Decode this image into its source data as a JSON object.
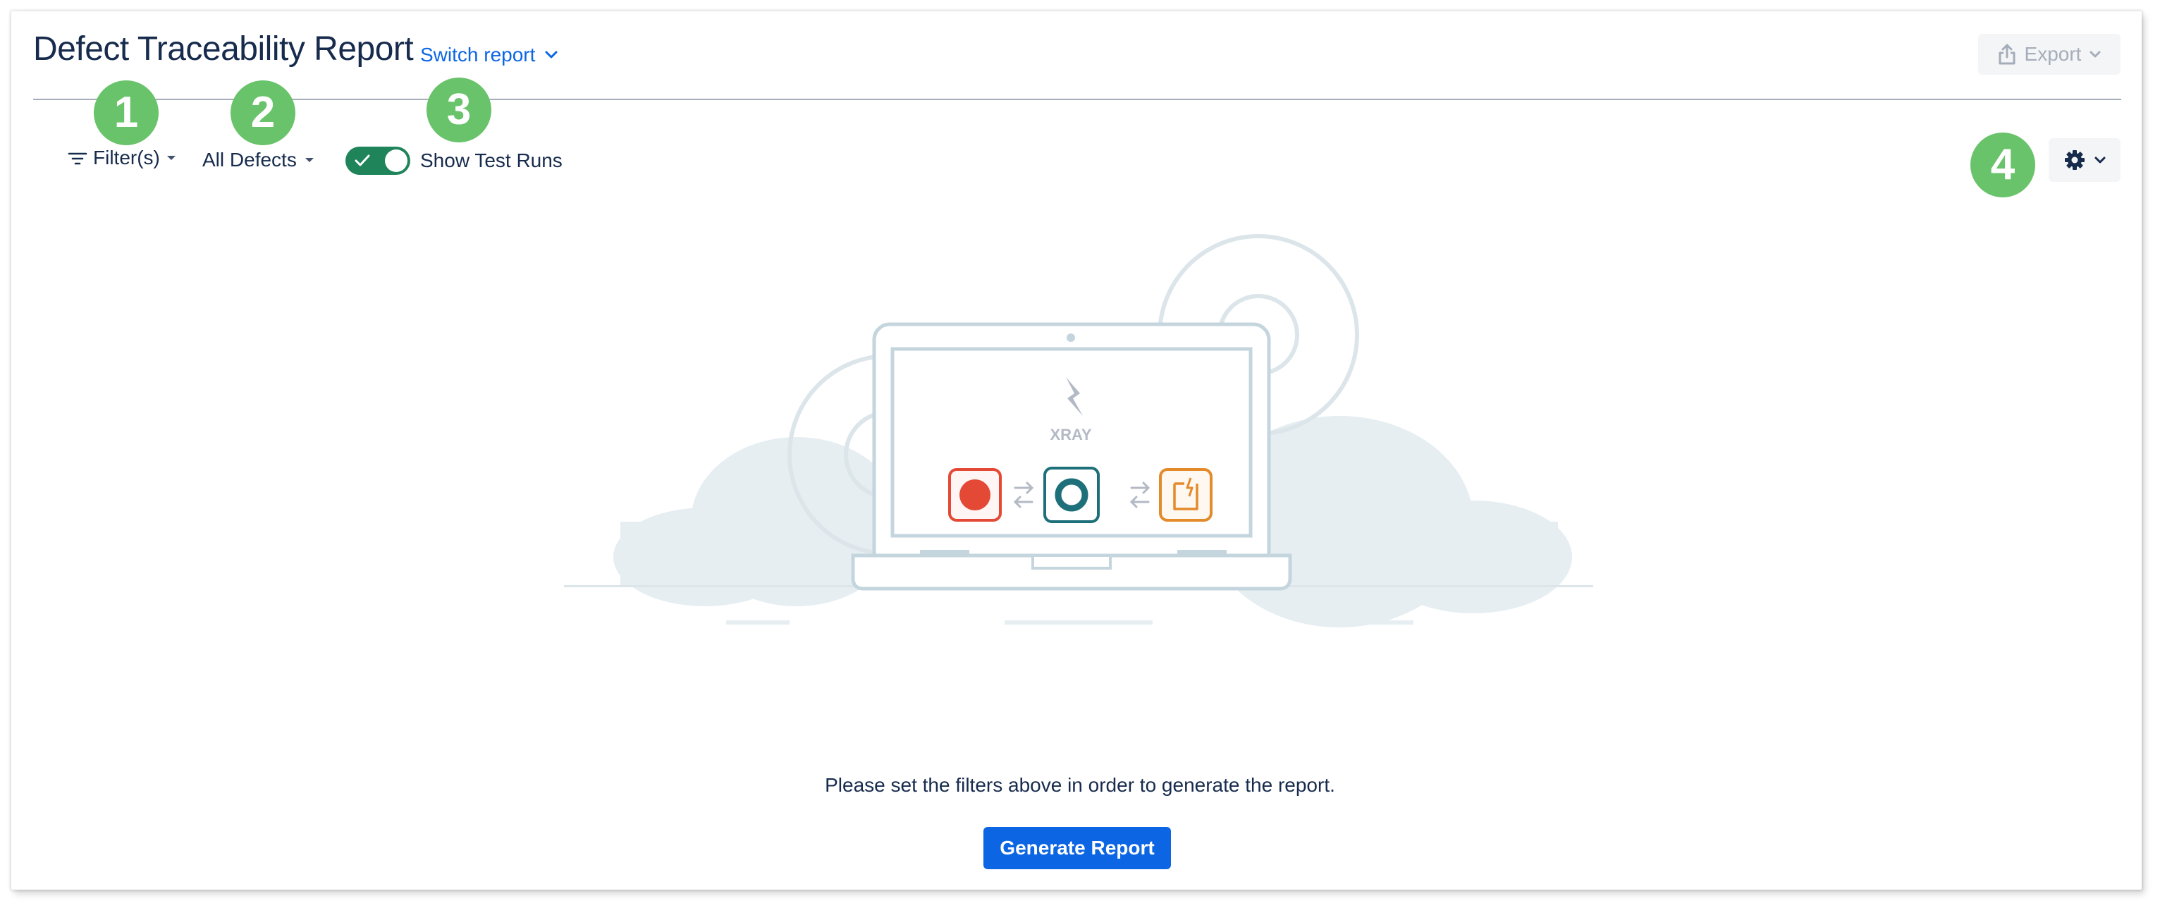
{
  "header": {
    "title": "Defect Traceability Report",
    "switch_report_label": "Switch report",
    "export_label": "Export"
  },
  "toolbar": {
    "filters_label": "Filter(s)",
    "defects_selected": "All Defects",
    "show_test_runs_label": "Show Test Runs",
    "show_test_runs_enabled": true
  },
  "badges": [
    "1",
    "2",
    "3",
    "4"
  ],
  "illustration": {
    "brand_text": "XRAY"
  },
  "main": {
    "empty_message": "Please set the filters above in order to generate the report.",
    "generate_label": "Generate Report"
  },
  "colors": {
    "accent": "#0c66e4",
    "toggle_on": "#1f845a",
    "badge": "#69c36a",
    "defect_red": "#e34935",
    "test_teal": "#1d6f7a",
    "requirement_orange": "#e38a2b"
  }
}
